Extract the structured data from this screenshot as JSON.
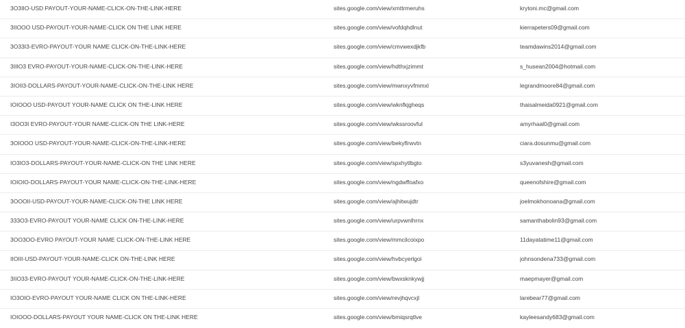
{
  "columns": [
    "title",
    "site",
    "email"
  ],
  "rows": [
    {
      "title": "3O3IIO-USD PAYOUT-YOUR-NAME-CLICK-ON-THE-LINK-HERE",
      "site": "sites.google.com/view/xmttrmeruhs",
      "email": "krytoni.mc@gmail.com"
    },
    {
      "title": "3IIOOO USD-PAYOUT-YOUR-NAME-CLICK ON THE LINK HERE",
      "site": "sites.google.com/view/vofdqhdlnut",
      "email": "kierrapeters09@gmail.com"
    },
    {
      "title": "3O33I3-EVRO-PAYOUT-YOUR NAME CLICK-ON-THE-LINK-HERE",
      "site": "sites.google.com/view/cmvwexdjkfb",
      "email": "teamdawins2014@gmail.com"
    },
    {
      "title": "3IIIO3 EVRO-PAYOUT-YOUR-NAME-CLICK-ON-THE-LINK-HERE",
      "site": "sites.google.com/view/hdthxjzimmt",
      "email": "s_husean2004@hotmail.com"
    },
    {
      "title": "3IOII3-DOLLARS-PAYOUT-YOUR-NAME-CLICK-ON-THE-LINK HERE",
      "site": "sites.google.com/view/mwnxyvfmmxl",
      "email": "legrandmoore84@gmail.com"
    },
    {
      "title": "IOIOOO USD-PAYOUT YOUR-NAME CLICK ON THE-LINK HERE",
      "site": "sites.google.com/view/wknfkjgheqs",
      "email": "thaisalmeida0921@gmail.com"
    },
    {
      "title": "I3OO3I EVRO-PAYOUT-YOUR NAME-CLICK-ON THE LINK-HERE",
      "site": "sites.google.com/view/wkssroovful",
      "email": "amyrhaal0@gmail.com"
    },
    {
      "title": "3OIOOO USD-PAYOUT-YOUR-NAME-CLICK-ON-THE-LINK-HERE",
      "site": "sites.google.com/view/bekyflrwvtn",
      "email": "ciara.dosunmu@gmail.com"
    },
    {
      "title": "IO3IO3-DOLLARS-PAYOUT-YOUR-NAME-CLICK-ON THE LINK HERE",
      "site": "sites.google.com/view/spxhytlbgto",
      "email": "s3yuvanesh@gmail.com"
    },
    {
      "title": "IOIOIO-DOLLARS-PAYOUT-YOUR NAME-CLICK-ON-THE-LINK-HERE",
      "site": "sites.google.com/view/ngdwffoafxo",
      "email": "queenofshire@gmail.com"
    },
    {
      "title": "3OOOII-USD-PAYOUT-YOUR-NAME-CLICK-ON-THE LINK HERE",
      "site": "sites.google.com/view/ajhitwujdtr",
      "email": "joelmokhonoana@gmail.com"
    },
    {
      "title": "333O3-EVRO-PAYOUT YOUR-NAME CLICK ON-THE-LINK-HERE",
      "site": "sites.google.com/view/urpvwnlhrnx",
      "email": "samanthabolin93@gmail.com"
    },
    {
      "title": "3OO3OO-EVRO PAYOUT-YOUR NAME CLICK-ON-THE-LINK HERE",
      "site": "sites.google.com/view/mmcilcoixpo",
      "email": "11dayatatime11@gmail.com"
    },
    {
      "title": "IIOIII-USD-PAYOUT-YOUR-NAME-CLICK ON-THE-LINK HERE",
      "site": "sites.google.com/view/hvbcyerlgoi",
      "email": "johnsondena733@gmail.com"
    },
    {
      "title": "3IIO33-EVRO-PAYOUT YOUR-NAME-CLICK-ON-THE-LINK-HERE",
      "site": "sites.google.com/view/bwxsknkywjj",
      "email": "maepmayer@gmail.com"
    },
    {
      "title": "IO3OIO-EVRO-PAYOUT YOUR-NAME CLICK ON THE-LINK-HERE",
      "site": "sites.google.com/view/revjhqvcxjl",
      "email": "larebear77@gmail.com"
    },
    {
      "title": "IOIOOO-DOLLARS-PAYOUT YOUR NAME-CLICK ON THE-LINK HERE",
      "site": "sites.google.com/view/bmiqsrqtlve",
      "email": "kayleesandy683@gmail.com"
    }
  ]
}
